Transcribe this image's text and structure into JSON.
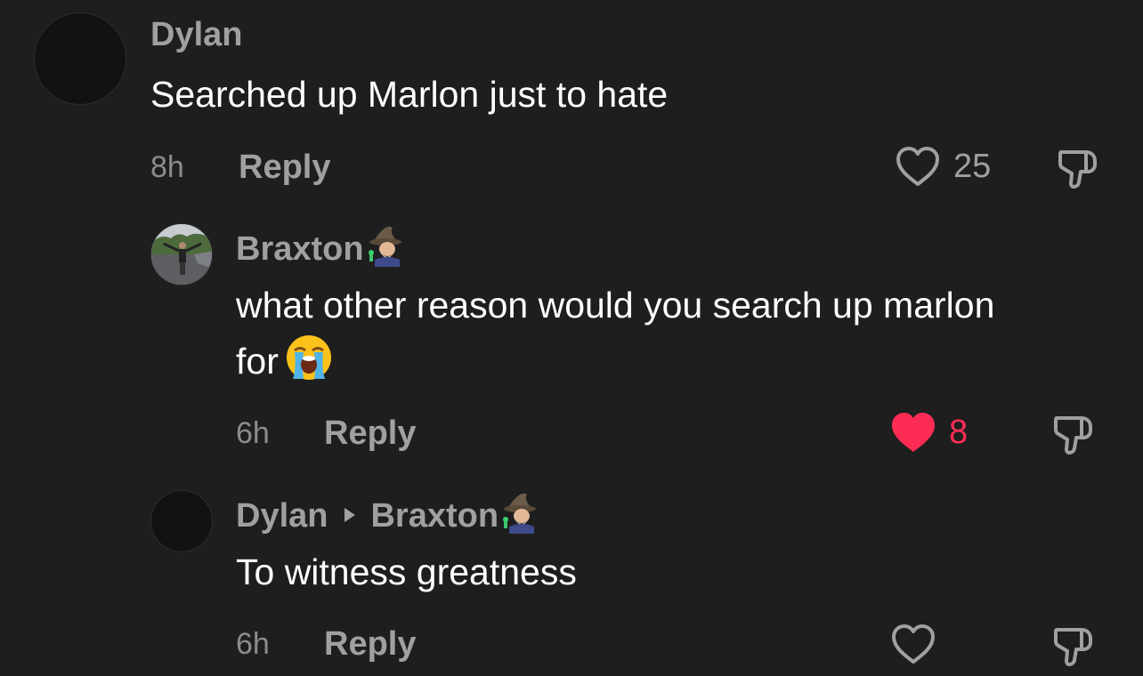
{
  "comments": [
    {
      "username": "Dylan",
      "text": "Searched up Marlon just to hate",
      "time": "8h",
      "reply_label": "Reply",
      "likes": "25",
      "liked": false
    },
    {
      "username": "Braxton",
      "text_line1": "what other reason would you search up marlon",
      "text_line2": "for",
      "time": "6h",
      "reply_label": "Reply",
      "likes": "8",
      "liked": true
    },
    {
      "username": "Dylan",
      "reply_to": "Braxton",
      "text": "To witness greatness",
      "time": "6h",
      "reply_label": "Reply",
      "liked": false
    }
  ],
  "colors": {
    "background": "#1e1e1e",
    "username": "#a0a0a0",
    "text": "#ffffff",
    "like_active": "#fe2c55"
  },
  "icons": {
    "like": "heart-icon",
    "dislike": "thumbs-down-icon",
    "reply_arrow": "caret-right-icon",
    "emoji_crying": "loudly-crying-face-icon",
    "emoji_wizard": "mage-icon"
  }
}
